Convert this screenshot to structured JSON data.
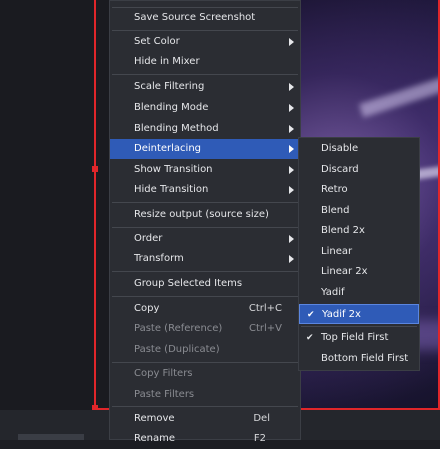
{
  "context_menu": {
    "items": [
      {
        "label": "Save Source Screenshot"
      },
      {
        "label": "Set Color"
      },
      {
        "label": "Hide in Mixer"
      },
      {
        "label": "Scale Filtering"
      },
      {
        "label": "Blending Mode"
      },
      {
        "label": "Blending Method"
      },
      {
        "label": "Deinterlacing"
      },
      {
        "label": "Show Transition"
      },
      {
        "label": "Hide Transition"
      },
      {
        "label": "Resize output (source size)"
      },
      {
        "label": "Order"
      },
      {
        "label": "Transform"
      },
      {
        "label": "Group Selected Items"
      },
      {
        "label": "Copy",
        "shortcut": "Ctrl+C"
      },
      {
        "label": "Paste (Reference)",
        "shortcut": "Ctrl+V"
      },
      {
        "label": "Paste (Duplicate)"
      },
      {
        "label": "Copy Filters"
      },
      {
        "label": "Paste Filters"
      },
      {
        "label": "Remove",
        "shortcut": "Del"
      },
      {
        "label": "Rename",
        "shortcut": "F2"
      }
    ]
  },
  "deinterlacing_submenu": {
    "items": [
      {
        "label": "Disable"
      },
      {
        "label": "Discard"
      },
      {
        "label": "Retro"
      },
      {
        "label": "Blend"
      },
      {
        "label": "Blend 2x"
      },
      {
        "label": "Linear"
      },
      {
        "label": "Linear 2x"
      },
      {
        "label": "Yadif"
      },
      {
        "label": "Yadif 2x"
      },
      {
        "label": "Top Field First"
      },
      {
        "label": "Bottom Field First"
      }
    ],
    "check_glyph": "✔"
  },
  "colors": {
    "highlight": "#2f5bb7",
    "selection_border": "#e0262a",
    "menu_bg": "#2b2d33"
  }
}
